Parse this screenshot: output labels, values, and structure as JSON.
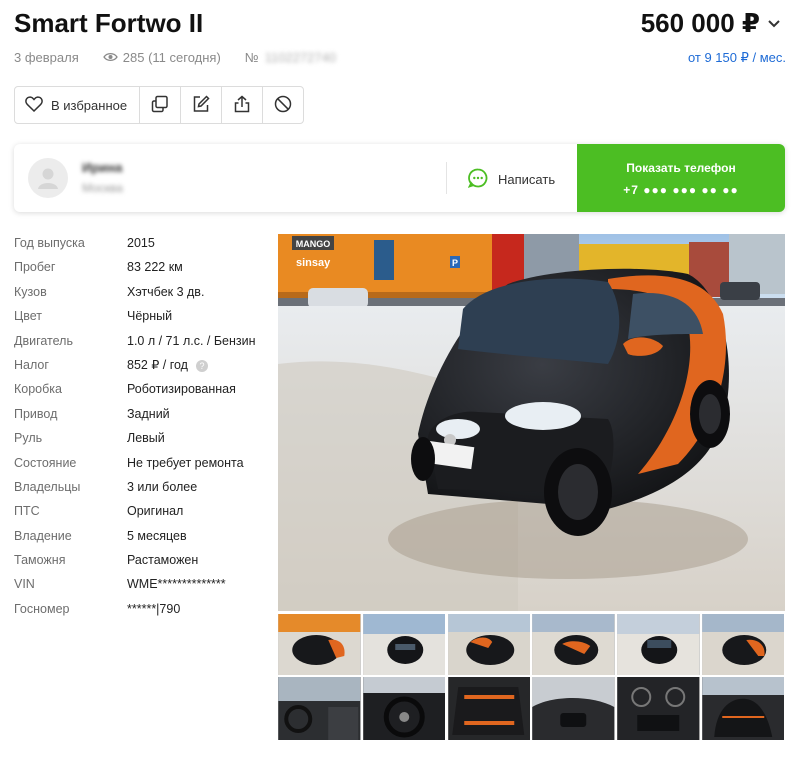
{
  "listing": {
    "title": "Smart Fortwo II",
    "price": "560 000 ₽",
    "date": "3 февраля",
    "views": "285 (11 сегодня)",
    "id_label": "№",
    "id_value": "1102272740",
    "credit": "от 9 150 ₽ / мес."
  },
  "actions": {
    "favorite_label": "В избранное"
  },
  "seller": {
    "name": "Ирина",
    "city": "Москва",
    "write_label": "Написать",
    "phone_label": "Показать телефон",
    "phone_masked": "+7 ●●● ●●● ●● ●●"
  },
  "specs": [
    {
      "key": "Год выпуска",
      "value": "2015"
    },
    {
      "key": "Пробег",
      "value": "83 222 км"
    },
    {
      "key": "Кузов",
      "value": "Хэтчбек 3 дв."
    },
    {
      "key": "Цвет",
      "value": "Чёрный"
    },
    {
      "key": "Двигатель",
      "value": "1.0 л / 71 л.с. / Бензин"
    },
    {
      "key": "Налог",
      "value": "852 ₽ / год"
    },
    {
      "key": "Коробка",
      "value": "Роботизированная"
    },
    {
      "key": "Привод",
      "value": "Задний"
    },
    {
      "key": "Руль",
      "value": "Левый"
    },
    {
      "key": "Состояние",
      "value": "Не требует ремонта"
    },
    {
      "key": "Владельцы",
      "value": "3 или более"
    },
    {
      "key": "ПТС",
      "value": "Оригинал"
    },
    {
      "key": "Владение",
      "value": "5 месяцев"
    },
    {
      "key": "Таможня",
      "value": "Растаможен"
    },
    {
      "key": "VIN",
      "value": "WME**************"
    },
    {
      "key": "Госномер",
      "value": "******|790"
    }
  ],
  "photo": {
    "store_sign_1": "MANGO",
    "store_sign_2": "sinsay",
    "parking_sign": "P"
  },
  "colors": {
    "accent_green": "#4cbe23",
    "link_blue": "#1e6bd6",
    "car_orange": "#e0661f"
  }
}
